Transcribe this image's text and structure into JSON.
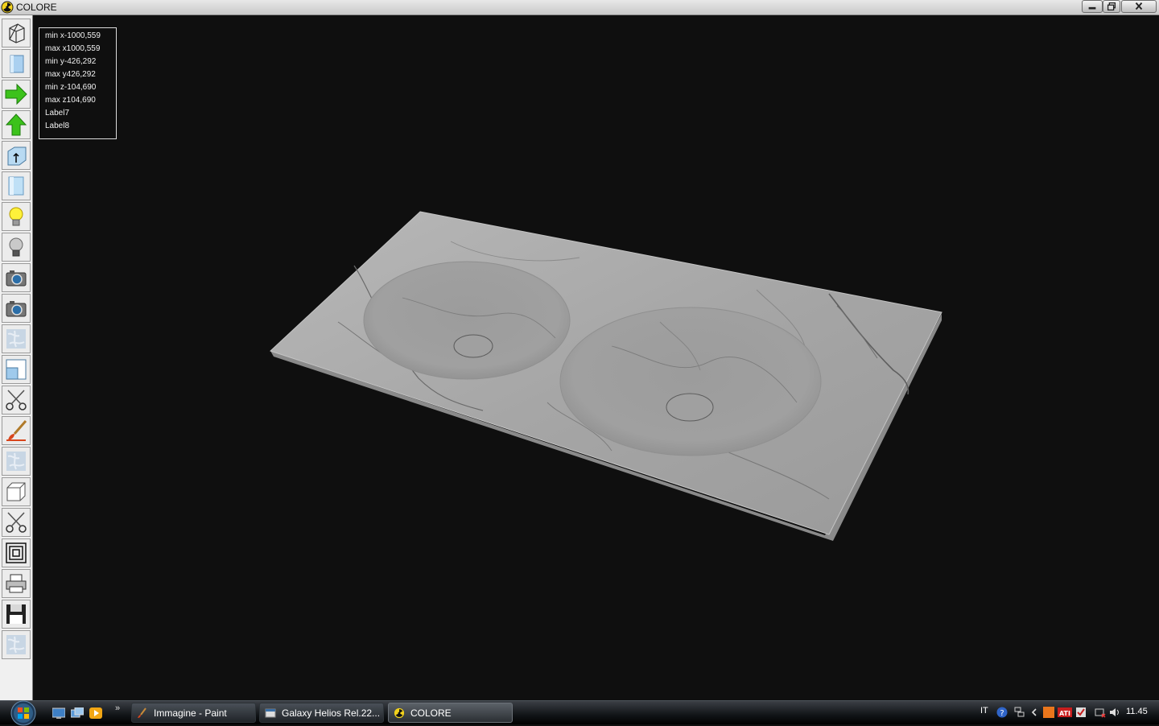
{
  "window": {
    "title": "COLORE",
    "icon": "radiation-icon"
  },
  "info_panel": {
    "lines": [
      "min x-1000,559",
      "max x1000,559",
      "min y-426,292",
      "max y426,292",
      "min z-104,690",
      "max z104,690",
      "Label7",
      "Label8"
    ]
  },
  "toolbar": {
    "tools": [
      {
        "icon": "wireframe-cube-icon"
      },
      {
        "icon": "solid-box-icon"
      },
      {
        "icon": "arrow-right-icon"
      },
      {
        "icon": "arrow-up-icon"
      },
      {
        "icon": "box-arrow-icon"
      },
      {
        "icon": "panel-icon"
      },
      {
        "icon": "lightbulb-on-icon"
      },
      {
        "icon": "lightbulb-off-icon"
      },
      {
        "icon": "camera-icon"
      },
      {
        "icon": "camera-icon"
      },
      {
        "icon": "texture-icon"
      },
      {
        "icon": "window-view-icon"
      },
      {
        "icon": "scissors-icon"
      },
      {
        "icon": "paintbrush-icon"
      },
      {
        "icon": "texture-icon"
      },
      {
        "icon": "white-cube-icon"
      },
      {
        "icon": "scissors-icon"
      },
      {
        "icon": "concentric-squares-icon"
      },
      {
        "icon": "printer-icon"
      },
      {
        "icon": "floppy-disk-icon"
      },
      {
        "icon": "texture-icon"
      }
    ]
  },
  "taskbar": {
    "tasks": [
      {
        "label": "Immagine - Paint",
        "icon": "paint-icon"
      },
      {
        "label": "Galaxy Helios  Rel.22...",
        "icon": "app-window-icon"
      },
      {
        "label": "COLORE",
        "icon": "radiation-icon"
      }
    ],
    "language": "IT",
    "clock": "11.45"
  },
  "colors": {
    "viewport_bg": "#0f0f0f",
    "marble": "#a9a9a9",
    "toolbar_bg": "#f0f0f0"
  }
}
